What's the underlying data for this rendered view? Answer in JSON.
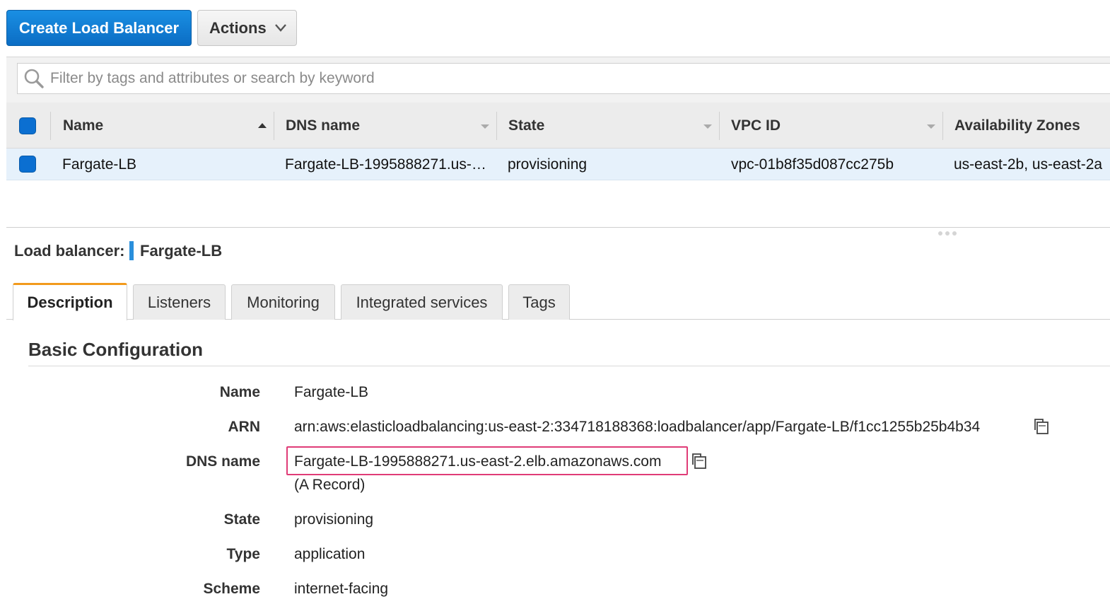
{
  "toolbar": {
    "create_label": "Create Load Balancer",
    "actions_label": "Actions"
  },
  "search": {
    "placeholder": "Filter by tags and attributes or search by keyword"
  },
  "table": {
    "columns": [
      "Name",
      "DNS name",
      "State",
      "VPC ID",
      "Availability Zones"
    ],
    "sort_indicator": "ascending",
    "rows": [
      {
        "name": "Fargate-LB",
        "dns_name": "Fargate-LB-1995888271.us-…",
        "state": "provisioning",
        "vpc_id": "vpc-01b8f35d087cc275b",
        "availability_zones": "us-east-2b, us-east-2a",
        "selected": true
      }
    ]
  },
  "detail": {
    "label": "Load balancer:",
    "name": "Fargate-LB",
    "tabs": [
      "Description",
      "Listeners",
      "Monitoring",
      "Integrated services",
      "Tags"
    ],
    "active_tab": "Description",
    "section_title": "Basic Configuration",
    "fields": {
      "name_key": "Name",
      "name_val": "Fargate-LB",
      "arn_key": "ARN",
      "arn_val": "arn:aws:elasticloadbalancing:us-east-2:334718188368:loadbalancer/app/Fargate-LB/f1cc1255b25b4b34",
      "dns_key": "DNS name",
      "dns_val": "Fargate-LB-1995888271.us-east-2.elb.amazonaws.com",
      "dns_note": "(A Record)",
      "state_key": "State",
      "state_val": "provisioning",
      "type_key": "Type",
      "type_val": "application",
      "scheme_key": "Scheme",
      "scheme_val": "internet-facing"
    }
  },
  "colors": {
    "primary_button": "#0b6dc4",
    "tab_accent": "#f29a1c",
    "highlight_border": "#e03c77",
    "selected_row": "#e6f1fb"
  }
}
